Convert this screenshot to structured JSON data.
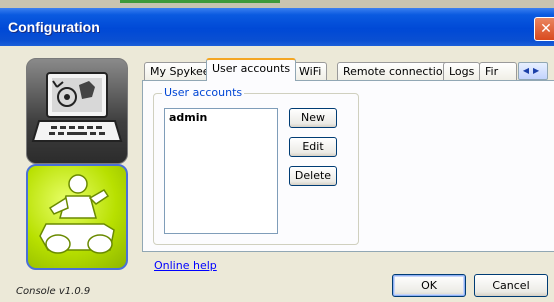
{
  "window": {
    "title": "Configuration",
    "close_glyph": "✕"
  },
  "icons": {
    "console": "laptop-robot-icon",
    "robot": "spykee-robot-icon"
  },
  "tabs": [
    {
      "label": "My Spykee",
      "active": false
    },
    {
      "label": "User accounts",
      "active": true
    },
    {
      "label": "WiFi",
      "active": false
    },
    {
      "label": "Remote connection",
      "active": false
    },
    {
      "label": "Logs",
      "active": false
    },
    {
      "label": "Fir",
      "active": false
    }
  ],
  "tab_scroll": {
    "arrows": "◀▶"
  },
  "user_accounts": {
    "group_label": "User accounts",
    "list": [
      "admin"
    ],
    "buttons": {
      "new": "New",
      "edit": "Edit",
      "delete": "Delete"
    }
  },
  "footer": {
    "online_help": "Online help",
    "version": "Console v1.0.9",
    "ok": "OK",
    "cancel": "Cancel"
  },
  "colors": {
    "titlebar": "#0049d6",
    "link": "#0000ff",
    "group_label": "#0046d5",
    "robot_tile": "#b8e000"
  }
}
